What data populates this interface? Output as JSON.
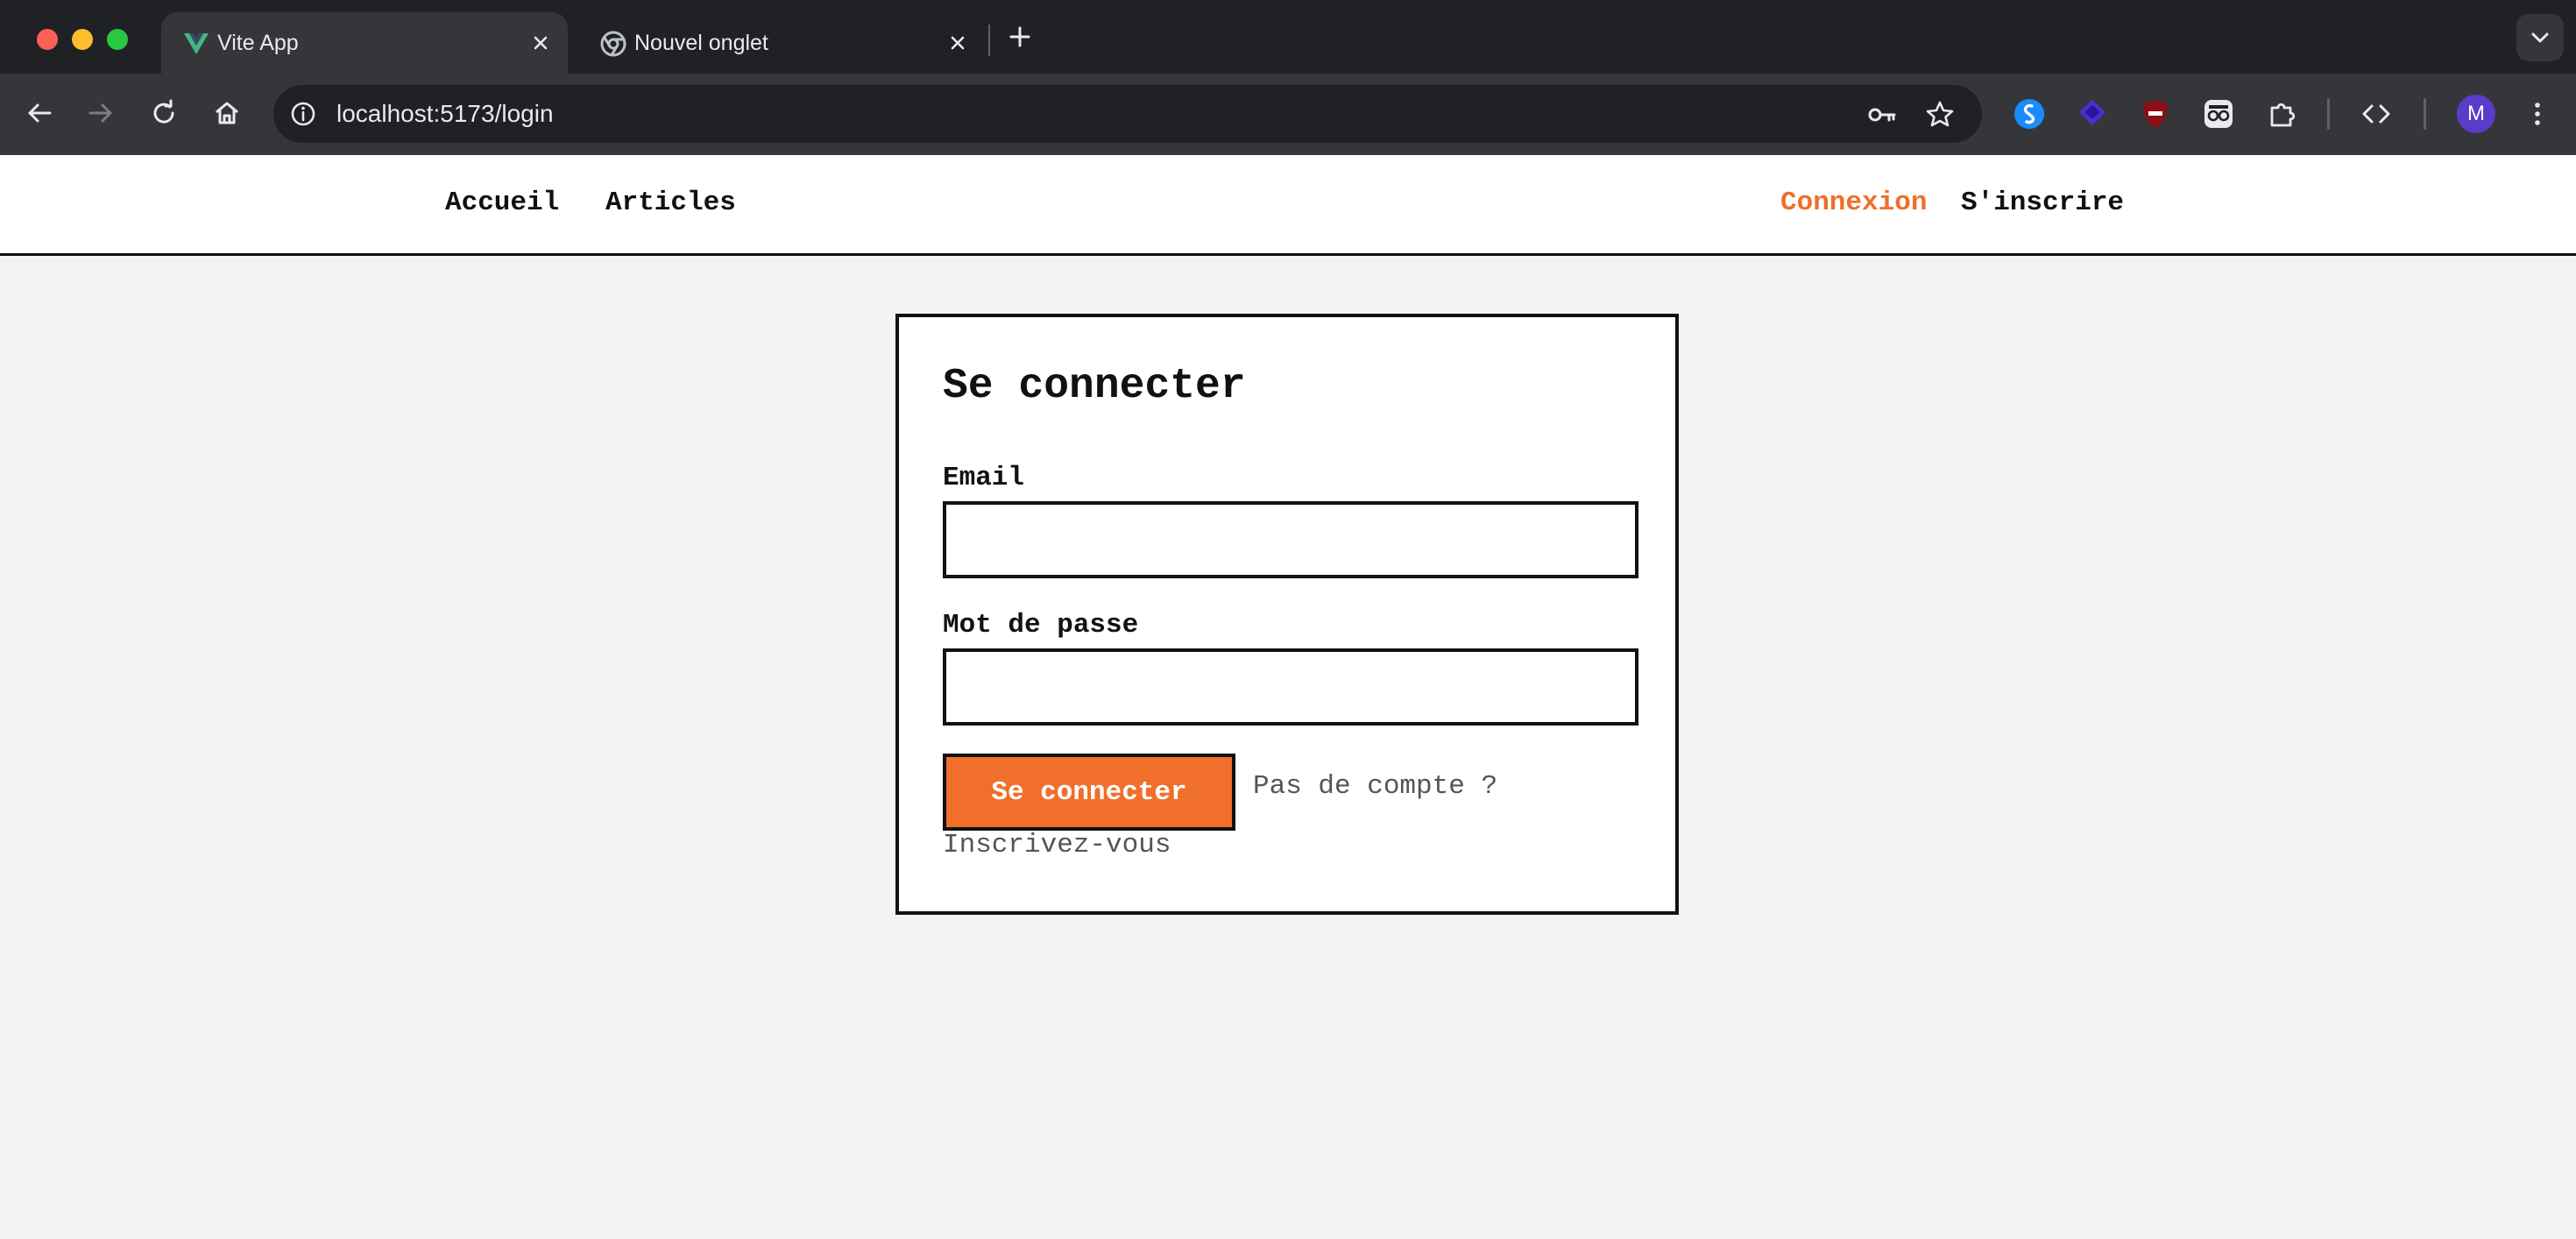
{
  "browser": {
    "tabs": [
      {
        "title": "Vite App",
        "active": true,
        "favicon": "vue-v-icon"
      },
      {
        "title": "Nouvel onglet",
        "active": false,
        "favicon": "chrome-icon"
      }
    ],
    "url": "localhost:5173/login",
    "profile_initial": "M",
    "colors": {
      "tabbar": "#202124",
      "toolbar": "#35363a",
      "text": "#e8eaed"
    }
  },
  "nav": {
    "left": [
      "Accueil",
      "Articles"
    ],
    "login": "Connexion",
    "register": "S'inscrire"
  },
  "login_form": {
    "title": "Se connecter",
    "email_label": "Email",
    "email_value": "",
    "password_label": "Mot de passe",
    "password_value": "",
    "submit_label": "Se connecter",
    "no_account_text": "Pas de compte ?",
    "signup_link": "Inscrivez-vous"
  },
  "colors": {
    "accent": "#ef6f2b",
    "border": "#111111",
    "background": "#f2f3f5",
    "muted_text": "#555555"
  }
}
